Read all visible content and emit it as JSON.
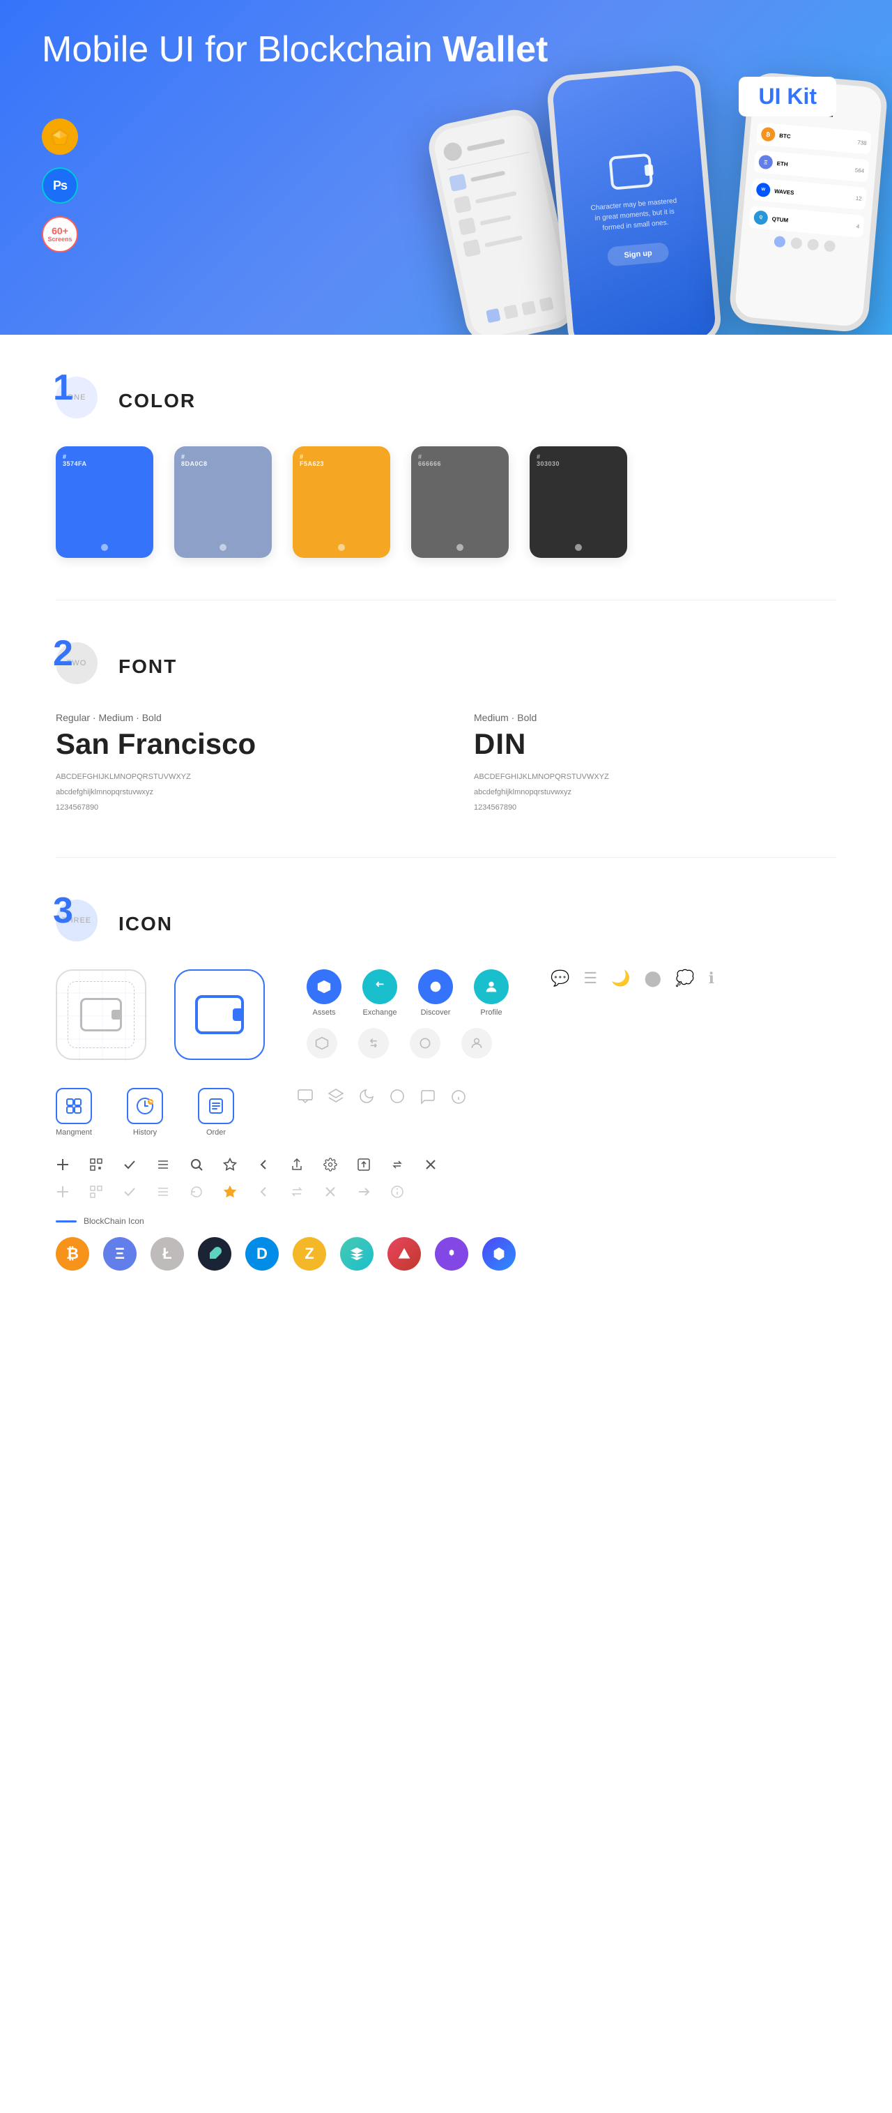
{
  "hero": {
    "title_regular": "Mobile UI for Blockchain ",
    "title_bold": "Wallet",
    "badge": "UI Kit",
    "tool_badges": [
      {
        "id": "sketch",
        "label": "Sketch"
      },
      {
        "id": "photoshop",
        "label": "PS"
      },
      {
        "id": "screens",
        "label": "60+\nScreens"
      }
    ]
  },
  "sections": {
    "color": {
      "number": "1",
      "number_sub": "ONE",
      "title": "COLOR",
      "swatches": [
        {
          "id": "blue",
          "hex": "#3574FA",
          "display": "#\n3574FA",
          "dot_color": "rgba(255,255,255,0.5)"
        },
        {
          "id": "gray-blue",
          "hex": "#8DA0C8",
          "display": "#\n8DA0C8",
          "dot_color": "rgba(255,255,255,0.5)"
        },
        {
          "id": "orange",
          "hex": "#F5A623",
          "display": "#\nF5A623",
          "dot_color": "rgba(255,255,255,0.5)"
        },
        {
          "id": "gray",
          "hex": "#666666",
          "display": "#\n666666",
          "dot_color": "rgba(255,255,255,0.5)"
        },
        {
          "id": "dark",
          "hex": "#303030",
          "display": "#\n303030",
          "dot_color": "rgba(255,255,255,0.5)"
        }
      ]
    },
    "font": {
      "number": "2",
      "number_sub": "TWO",
      "title": "FONT",
      "fonts": [
        {
          "id": "san-francisco",
          "style_label": "Regular · Medium · Bold",
          "name": "San Francisco",
          "uppercase": "ABCDEFGHIJKLMNOPQRSTUVWXYZ",
          "lowercase": "abcdefghijklmnopqrstuvwxyz",
          "numbers": "1234567890"
        },
        {
          "id": "din",
          "style_label": "Medium · Bold",
          "name": "DIN",
          "uppercase": "ABCDEFGHIJKLMNOPQRSTUVWXYZ",
          "lowercase": "abcdefghijklmnopqrstuvwxyz",
          "numbers": "1234567890"
        }
      ]
    },
    "icon": {
      "number": "3",
      "number_sub": "THREE",
      "title": "ICON",
      "nav_icons": [
        {
          "id": "assets",
          "label": "Assets",
          "symbol": "◆",
          "color": "blue"
        },
        {
          "id": "exchange",
          "label": "Exchange",
          "symbol": "⇄",
          "color": "teal"
        },
        {
          "id": "discover",
          "label": "Discover",
          "symbol": "●",
          "color": "blue"
        },
        {
          "id": "profile",
          "label": "Profile",
          "symbol": "👤",
          "color": "teal"
        }
      ],
      "mgmt_icons": [
        {
          "id": "management",
          "label": "Mangment",
          "symbol": "▤"
        },
        {
          "id": "history",
          "label": "History",
          "symbol": "◷"
        },
        {
          "id": "order",
          "label": "Order",
          "symbol": "☰"
        }
      ],
      "utility_icons": [
        "+",
        "⊞",
        "✓",
        "⊟",
        "🔍",
        "☆",
        "<",
        "≪",
        "⚙",
        "⊡",
        "⇄",
        "✕"
      ],
      "utility_icons_light": [
        "+",
        "⊞",
        "✓",
        "⊟",
        "↺",
        "★",
        "<",
        "↔",
        "✕",
        "→",
        "ℹ"
      ],
      "blockchain_label": "BlockChain Icon",
      "crypto_icons": [
        {
          "id": "bitcoin",
          "symbol": "₿",
          "class": "ci-btc"
        },
        {
          "id": "ethereum",
          "symbol": "Ξ",
          "class": "ci-eth"
        },
        {
          "id": "litecoin",
          "symbol": "Ł",
          "class": "ci-ltc"
        },
        {
          "id": "feather",
          "symbol": "✦",
          "class": "ci-feather"
        },
        {
          "id": "dash",
          "symbol": "D",
          "class": "ci-dash"
        },
        {
          "id": "zcash",
          "symbol": "Z",
          "class": "ci-zcash"
        },
        {
          "id": "holo",
          "symbol": "H",
          "class": "ci-holo"
        },
        {
          "id": "ark",
          "symbol": "Δ",
          "class": "ci-ark"
        },
        {
          "id": "matic",
          "symbol": "M",
          "class": "ci-matic"
        },
        {
          "id": "poly",
          "symbol": "P",
          "class": "ci-poly"
        }
      ]
    }
  }
}
